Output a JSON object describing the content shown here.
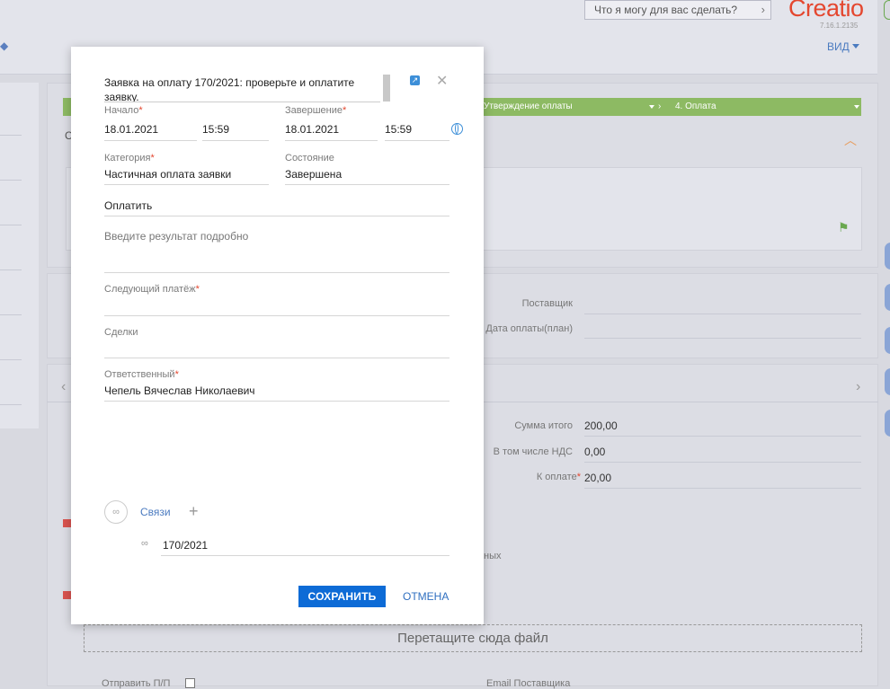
{
  "header": {
    "search_placeholder": "Что я могу для вас сделать?",
    "logo_text": "Creatio",
    "version": "7.16.1.2135",
    "view_label": "ВИД"
  },
  "stages": {
    "approve_label": "Утверждение оплаты",
    "pay_label": "4. Оплата",
    "color": "#8dba63"
  },
  "background": {
    "supplier_label": "Поставщик",
    "pay_date_label": "Дата оплаты(план)",
    "total_label": "Сумма итого",
    "total_value": "200,00",
    "vat_label": "В том числе НДС",
    "vat_value": "0,00",
    "to_pay_label": "К оплате",
    "to_pay_value": "20,00",
    "partial_text": "ных",
    "dropzone_text": "Перетащите сюда файл",
    "send_label": "Отправить П/П",
    "email_label": "Email Поставщика",
    "col_letter": "С"
  },
  "modal": {
    "title": "Заявка на оплату 170/2021: проверьте и оплатите заявку.",
    "start_label": "Начало",
    "start_date": "18.01.2021",
    "start_time": "15:59",
    "end_label": "Завершение",
    "end_date": "18.01.2021",
    "end_time": "15:59",
    "category_label": "Категория",
    "category_value": "Частичная оплата заявки",
    "status_label": "Состояние",
    "status_value": "Завершена",
    "subject_value": "Оплатить",
    "result_placeholder": "Введите результат подробно",
    "next_payment_label": "Следующий платёж",
    "deals_label": "Сделки",
    "owner_label": "Ответственный",
    "owner_value": "Чепель Вячеслав Николаевич",
    "links_label": "Связи",
    "link_value": "170/2021",
    "save_label": "СОХРАНИТЬ",
    "cancel_label": "ОТМЕНА",
    "primary_color": "#0d6bd6"
  }
}
